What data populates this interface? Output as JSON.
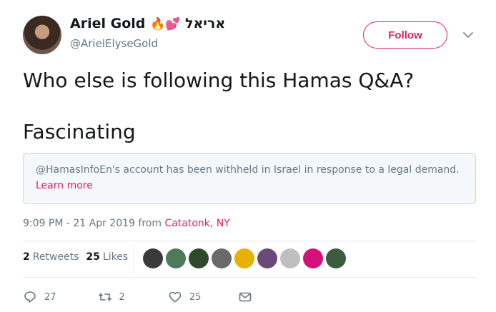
{
  "author": {
    "name": "Ariel Gold",
    "emoji": "🔥💕",
    "hebrew_name": "אריאל",
    "handle": "@ArielElyseGold"
  },
  "follow_label": "Follow",
  "tweet": {
    "line1": "Who else is following this Hamas Q&A?",
    "line2": "Fascinating"
  },
  "withheld": {
    "text": "@HamasInfoEn's account has been withheld in Israel in response to a legal demand.",
    "learn_more": "Learn more"
  },
  "meta": {
    "time": "9:09 PM - 21 Apr 2019",
    "from": "from",
    "location": "Catatonk, NY"
  },
  "stats": {
    "retweets_count": "2",
    "retweets_label": "Retweets",
    "likes_count": "25",
    "likes_label": "Likes"
  },
  "likers": [
    {
      "color": "#3a3a3a"
    },
    {
      "color": "#4d7a5a"
    },
    {
      "color": "#2f4a2a"
    },
    {
      "color": "#6a6a6a"
    },
    {
      "color": "#e8b000"
    },
    {
      "color": "#6b4a7a"
    },
    {
      "color": "#bfbfbf"
    },
    {
      "color": "#d4117a"
    },
    {
      "color": "#3d5b3d"
    }
  ],
  "actions": {
    "reply_count": "27",
    "retweet_count": "2",
    "like_count": "25"
  },
  "colors": {
    "accent": "#e0245e",
    "secondary_text": "#657786",
    "border": "#ccd6dd"
  },
  "icons": [
    "chevron-down-icon",
    "reply-icon",
    "retweet-icon",
    "heart-icon",
    "message-icon"
  ]
}
